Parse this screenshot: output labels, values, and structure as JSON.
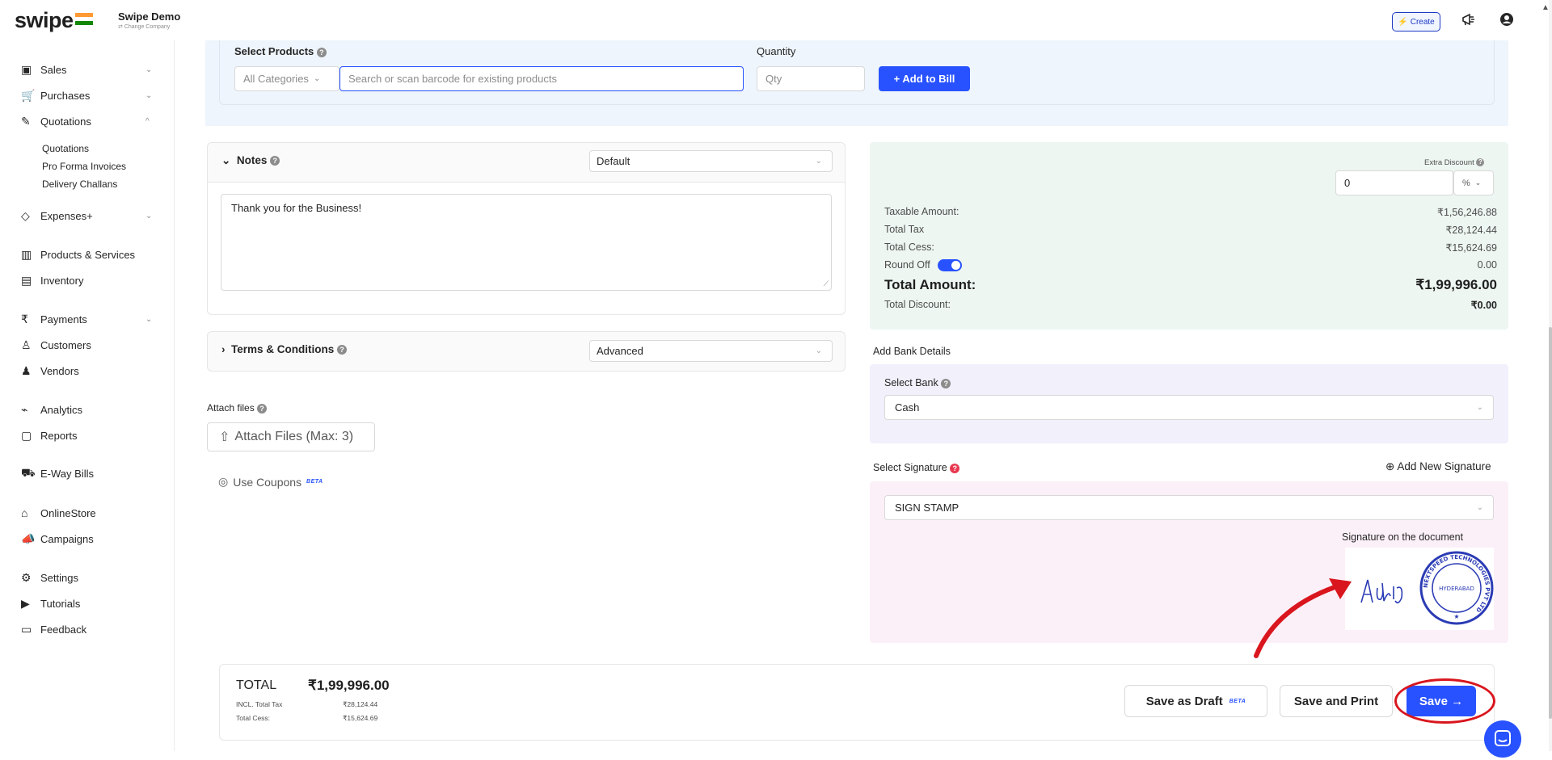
{
  "app": {
    "logo": "swipe",
    "company_name": "Swipe Demo",
    "company_sub": "⇄ Change Company",
    "create_label": "Create"
  },
  "sidebar": {
    "items": [
      {
        "label": "Sales",
        "icon": "sales-icon",
        "glyph": "▣",
        "chevron": "⌄"
      },
      {
        "label": "Purchases",
        "icon": "cart-icon",
        "glyph": "🛒",
        "chevron": "⌄"
      },
      {
        "label": "Quotations",
        "icon": "pen-icon",
        "glyph": "✎",
        "chevron": "^"
      },
      {
        "label": "Expenses+",
        "icon": "tag-icon",
        "glyph": "◇",
        "chevron": "⌄"
      },
      {
        "label": "Products & Services",
        "icon": "barcode-icon",
        "glyph": "▥",
        "chevron": ""
      },
      {
        "label": "Inventory",
        "icon": "inventory-icon",
        "glyph": "▤",
        "chevron": ""
      },
      {
        "label": "Payments",
        "icon": "rupee-icon",
        "glyph": "₹",
        "chevron": "⌄"
      },
      {
        "label": "Customers",
        "icon": "user-icon",
        "glyph": "♙",
        "chevron": ""
      },
      {
        "label": "Vendors",
        "icon": "users-icon",
        "glyph": "♟",
        "chevron": ""
      },
      {
        "label": "Analytics",
        "icon": "chart-icon",
        "glyph": "⌁",
        "chevron": ""
      },
      {
        "label": "Reports",
        "icon": "report-icon",
        "glyph": "▢",
        "chevron": ""
      },
      {
        "label": "E-Way Bills",
        "icon": "truck-icon",
        "glyph": "⛟",
        "chevron": ""
      },
      {
        "label": "OnlineStore",
        "icon": "store-icon",
        "glyph": "⌂",
        "chevron": ""
      },
      {
        "label": "Campaigns",
        "icon": "megaphone-icon",
        "glyph": "📣",
        "chevron": ""
      },
      {
        "label": "Settings",
        "icon": "gear-icon",
        "glyph": "⚙",
        "chevron": ""
      },
      {
        "label": "Tutorials",
        "icon": "youtube-icon",
        "glyph": "▶",
        "chevron": ""
      },
      {
        "label": "Feedback",
        "icon": "feedback-icon",
        "glyph": "▭",
        "chevron": ""
      }
    ],
    "quotation_sub": [
      "Quotations",
      "Pro Forma Invoices",
      "Delivery Challans"
    ]
  },
  "products": {
    "label": "Select Products",
    "category": "All Categories",
    "search_placeholder": "Search or scan barcode for existing products",
    "quantity_label": "Quantity",
    "qty_placeholder": "Qty",
    "add_label": "+ Add to Bill"
  },
  "notes": {
    "title": "Notes",
    "template": "Default",
    "text": "Thank you for the Business!"
  },
  "terms": {
    "title": "Terms & Conditions",
    "template": "Advanced"
  },
  "attach": {
    "label": "Attach files",
    "button": "Attach Files (Max: 3)"
  },
  "coupons": {
    "label": "Use Coupons",
    "beta": "BETA"
  },
  "totals": {
    "extra_discount_label": "Extra Discount",
    "extra_discount_value": "0",
    "discount_unit": "%",
    "taxable_label": "Taxable Amount:",
    "taxable": "₹1,56,246.88",
    "tax_label": "Total Tax",
    "tax": "₹28,124.44",
    "cess_label": "Total Cess:",
    "cess": "₹15,624.69",
    "roundoff_label": "Round Off",
    "roundoff": "0.00",
    "total_label": "Total Amount:",
    "total": "₹1,99,996.00",
    "discount_label": "Total Discount:",
    "discount": "₹0.00"
  },
  "bank": {
    "title": "Add Bank Details",
    "select_label": "Select Bank",
    "value": "Cash"
  },
  "signature": {
    "title": "Select Signature",
    "add_label": "Add New Signature",
    "value": "SIGN STAMP",
    "doc_label": "Signature on the document",
    "stamp_text": "NEXTSPEED TECHNOLOGIES PVT LTD",
    "stamp_city": "HYDERABAD",
    "signed_name": "Aditya"
  },
  "footer": {
    "total_label": "TOTAL",
    "total": "₹1,99,996.00",
    "incl_tax_label": "INCL. Total Tax",
    "incl_tax": "₹28,124.44",
    "cess_label": "Total Cess:",
    "cess": "₹15,624.69",
    "draft_label": "Save as Draft",
    "draft_beta": "BETA",
    "print_label": "Save and Print",
    "save_label": "Save →"
  },
  "colors": {
    "primary": "#2852ff",
    "annotation": "#d9161e"
  }
}
